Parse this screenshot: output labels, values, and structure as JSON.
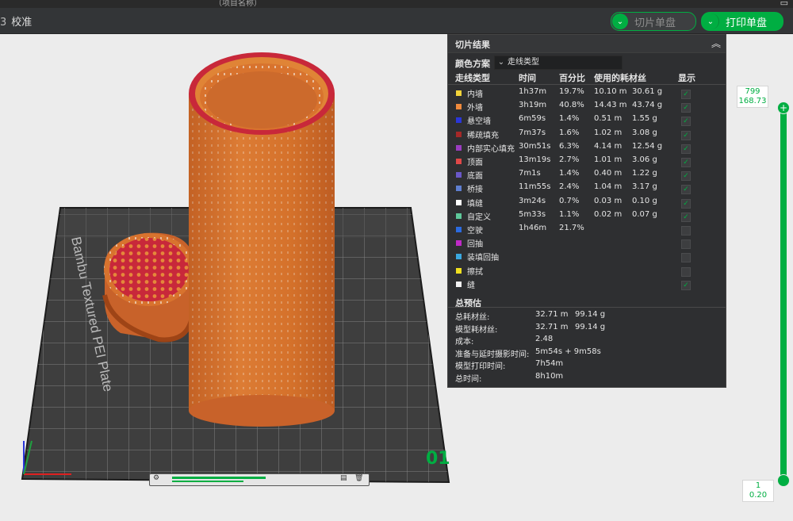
{
  "title_fragment": "（项目名称）",
  "toolbar": {
    "calibration_label": "校准",
    "slice_button": "切片单盘",
    "print_button": "打印单盘"
  },
  "panel": {
    "title": "切片结果",
    "color_scheme_label": "颜色方案",
    "color_scheme_value": "走线类型",
    "headers": [
      "走线类型",
      "时间",
      "百分比",
      "使用的耗材丝",
      "显示"
    ],
    "rows": [
      {
        "name": "内墙",
        "color": "#f2d43a",
        "time": "1h37m",
        "pct": "19.7%",
        "len": "10.10 m",
        "wt": "30.61 g",
        "shown": true
      },
      {
        "name": "外墙",
        "color": "#f08a3c",
        "time": "3h19m",
        "pct": "40.8%",
        "len": "14.43 m",
        "wt": "43.74 g",
        "shown": true
      },
      {
        "name": "悬空墙",
        "color": "#2a36d8",
        "time": "6m59s",
        "pct": "1.4%",
        "len": "0.51 m",
        "wt": "1.55 g",
        "shown": true
      },
      {
        "name": "稀疏填充",
        "color": "#a52828",
        "time": "7m37s",
        "pct": "1.6%",
        "len": "1.02 m",
        "wt": "3.08 g",
        "shown": true
      },
      {
        "name": "内部实心填充",
        "color": "#9a3cc0",
        "time": "30m51s",
        "pct": "6.3%",
        "len": "4.14 m",
        "wt": "12.54 g",
        "shown": true
      },
      {
        "name": "顶面",
        "color": "#e04848",
        "time": "13m19s",
        "pct": "2.7%",
        "len": "1.01 m",
        "wt": "3.06 g",
        "shown": true
      },
      {
        "name": "底面",
        "color": "#6a58c8",
        "time": "7m1s",
        "pct": "1.4%",
        "len": "0.40 m",
        "wt": "1.22 g",
        "shown": true
      },
      {
        "name": "桥接",
        "color": "#5f7fd0",
        "time": "11m55s",
        "pct": "2.4%",
        "len": "1.04 m",
        "wt": "3.17 g",
        "shown": true
      },
      {
        "name": "填缝",
        "color": "#ffffff",
        "time": "3m24s",
        "pct": "0.7%",
        "len": "0.03 m",
        "wt": "0.10 g",
        "shown": true
      },
      {
        "name": "自定义",
        "color": "#5ec89a",
        "time": "5m33s",
        "pct": "1.1%",
        "len": "0.02 m",
        "wt": "0.07 g",
        "shown": true
      },
      {
        "name": "空驶",
        "color": "#2b6be0",
        "time": "1h46m",
        "pct": "21.7%",
        "len": "",
        "wt": "",
        "shown": false
      },
      {
        "name": "回抽",
        "color": "#c02ac8",
        "time": "",
        "pct": "",
        "len": "",
        "wt": "",
        "shown": false
      },
      {
        "name": "装填回抽",
        "color": "#3aa8e0",
        "time": "",
        "pct": "",
        "len": "",
        "wt": "",
        "shown": false
      },
      {
        "name": "擦拭",
        "color": "#f0e020",
        "time": "",
        "pct": "",
        "len": "",
        "wt": "",
        "shown": false
      },
      {
        "name": "缝",
        "color": "#f2f2f2",
        "time": "",
        "pct": "",
        "len": "",
        "wt": "",
        "shown": true
      }
    ],
    "estimate_title": "总预估",
    "estimates": [
      {
        "label": "总耗材丝:",
        "v1": "32.71 m",
        "v2": "99.14 g"
      },
      {
        "label": "模型耗材丝:",
        "v1": "32.71 m",
        "v2": "99.14 g"
      },
      {
        "label": "成本:",
        "v1": "2.48",
        "v2": ""
      },
      {
        "label": "准备与延时摄影时间:",
        "v1": "5m54s + 9m58s",
        "v2": ""
      },
      {
        "label": "模型打印时间:",
        "v1": "7h54m",
        "v2": ""
      },
      {
        "label": "总时间:",
        "v1": "8h10m",
        "v2": ""
      }
    ]
  },
  "plate": {
    "label": "Bambu Textured PEI Plate",
    "number": "01"
  },
  "slider": {
    "top_layer": "799",
    "top_height": "168.73",
    "bottom_layer": "1",
    "bottom_height": "0.20"
  },
  "colors": {
    "accent": "#00ae42",
    "model_orange": "#d8732e",
    "model_red": "#c8283a"
  }
}
